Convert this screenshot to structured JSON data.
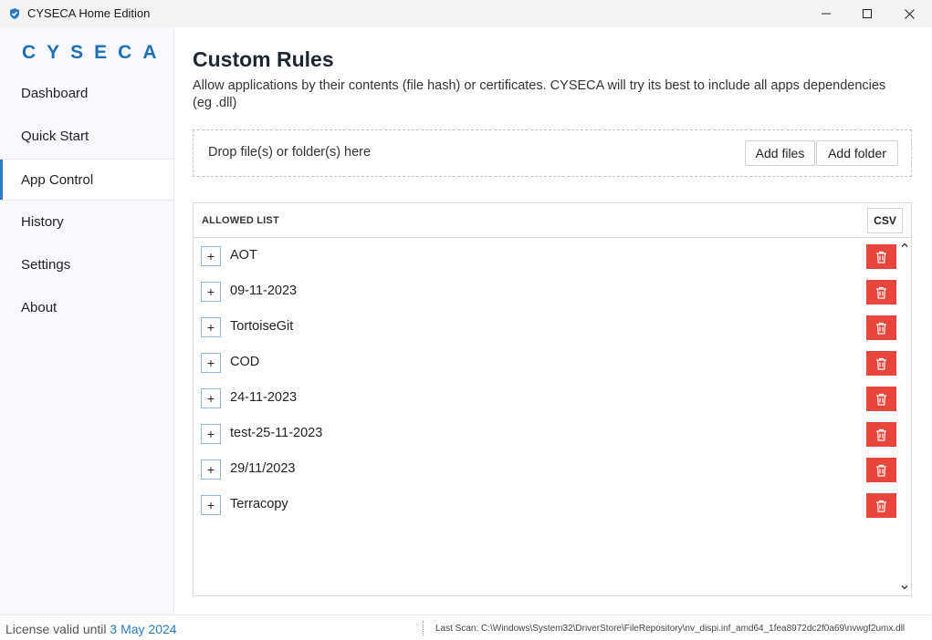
{
  "window": {
    "title": "CYSECA Home Edition"
  },
  "sidebar": {
    "logo": "CYSECA",
    "items": [
      {
        "label": "Dashboard"
      },
      {
        "label": "Quick Start"
      },
      {
        "label": "App Control",
        "active": true
      },
      {
        "label": "History"
      },
      {
        "label": "Settings"
      },
      {
        "label": "About"
      }
    ]
  },
  "main": {
    "title": "Custom Rules",
    "description": "Allow applications by their contents (file hash) or certificates. CYSECA will try its best to include all apps dependencies (eg .dll)",
    "dropzone": {
      "text": "Drop file(s) or folder(s) here",
      "add_files_label": "Add files",
      "add_folder_label": "Add folder"
    },
    "allowed_list": {
      "title": "ALLOWED LIST",
      "csv_label": "CSV",
      "items": [
        {
          "expand": "+",
          "name": "AOT"
        },
        {
          "expand": "+",
          "name": "09-11-2023"
        },
        {
          "expand": "+",
          "name": "TortoiseGit"
        },
        {
          "expand": "+",
          "name": "COD"
        },
        {
          "expand": "+",
          "name": "24-11-2023"
        },
        {
          "expand": "+",
          "name": "test-25-11-2023"
        },
        {
          "expand": "+",
          "name": "29/11/2023"
        },
        {
          "expand": "+",
          "name": "Terracopy"
        }
      ]
    }
  },
  "status": {
    "license_prefix": "License valid until ",
    "license_date": "3 May 2024",
    "last_scan": "Last Scan: C:\\Windows\\System32\\DriverStore\\FileRepository\\nv_dispi.inf_amd64_1fea8972dc2f0a69\\nvwgf2umx.dll"
  },
  "colors": {
    "accent": "#2a7bc4",
    "logo": "#1f6fb8",
    "delete": "#e8453c"
  },
  "icons": {
    "app": "shield-icon",
    "delete": "trash-icon",
    "scroll_up": "chevron-up-icon",
    "scroll_down": "chevron-down-icon"
  }
}
